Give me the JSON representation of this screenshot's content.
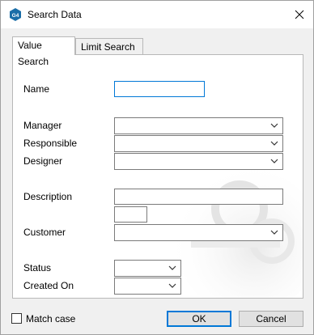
{
  "window": {
    "title": "Search Data",
    "app_icon_text": "G4"
  },
  "tabs": [
    {
      "label": "Value Search",
      "active": true
    },
    {
      "label": "Limit Search",
      "active": false
    }
  ],
  "form": {
    "name_label": "Name",
    "name_value": "",
    "manager_label": "Manager",
    "responsible_label": "Responsible",
    "designer_label": "Designer",
    "description_label": "Description",
    "customer_label": "Customer",
    "status_label": "Status",
    "created_on_label": "Created On"
  },
  "footer": {
    "match_case_label": "Match case",
    "match_case_checked": false,
    "ok_label": "OK",
    "cancel_label": "Cancel"
  },
  "colors": {
    "accent": "#0078d7",
    "icon_bg": "#1b6ea8"
  }
}
